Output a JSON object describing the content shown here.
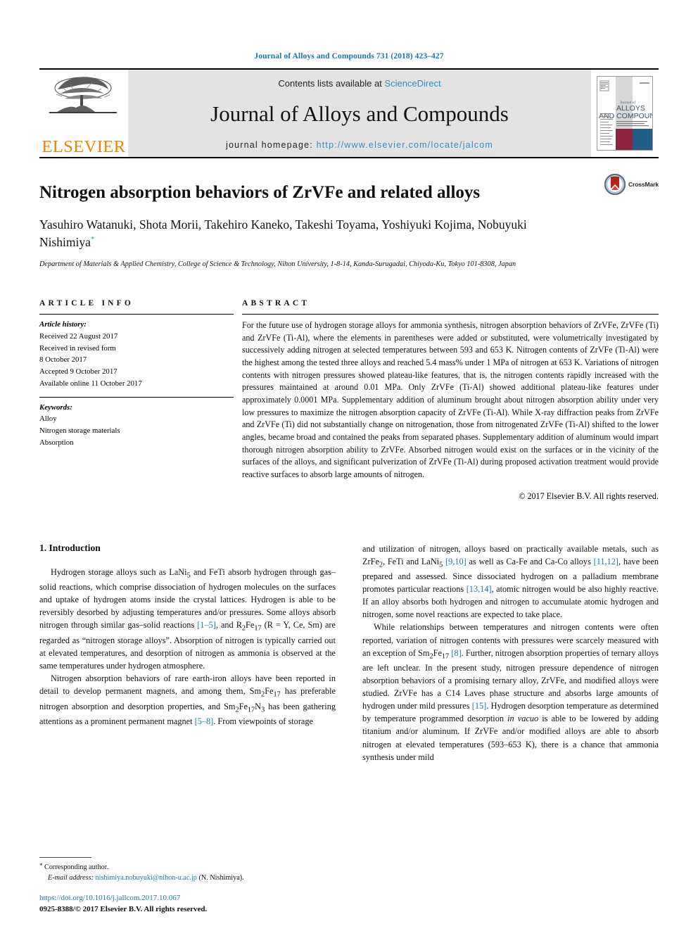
{
  "running_head": "Journal of Alloys and Compounds 731 (2018) 423–427",
  "masthead": {
    "publisher": "ELSEVIER",
    "contents_prefix": "Contents lists available at ",
    "contents_link": "ScienceDirect",
    "journal_name": "Journal of Alloys and Compounds",
    "homepage_prefix": "journal homepage: ",
    "homepage_url": "http://www.elsevier.com/locate/jalcom",
    "cover_title_small": "Journal of",
    "cover_title_line1": "ALLOYS",
    "cover_title_line2": "AND COMPOUNDS",
    "accent_link_color": "#2f8fc4",
    "publisher_color": "#ef8200",
    "panel_color": "#e3e3e3",
    "cover_maroon": "#8d2341",
    "cover_blue": "#1f5e86"
  },
  "article": {
    "title": "Nitrogen absorption behaviors of ZrVFe and related alloys",
    "authors": "Yasuhiro Watanuki, Shota Morii, Takehiro Kaneko, Takeshi Toyama, Yoshiyuki Kojima, Nobuyuki Nishimiya",
    "corresponding_marker": "*",
    "affiliation": "Department of Materials & Applied Chemistry, College of Science & Technology, Nihon University, 1-8-14, Kanda-Surugadai, Chiyoda-Ku, Tokyo 101-8308, Japan",
    "crossmark_label": "CrossMark"
  },
  "article_info": {
    "heading": "ARTICLE INFO",
    "history_label": "Article history:",
    "history": [
      "Received 22 August 2017",
      "Received in revised form",
      "8 October 2017",
      "Accepted 9 October 2017",
      "Available online 11 October 2017"
    ],
    "keywords_label": "Keywords:",
    "keywords": [
      "Alloy",
      "Nitrogen storage materials",
      "Absorption"
    ]
  },
  "abstract": {
    "heading": "ABSTRACT",
    "text": "For the future use of hydrogen storage alloys for ammonia synthesis, nitrogen absorption behaviors of ZrVFe, ZrVFe (Ti) and ZrVFe (Ti-Al), where the elements in parentheses were added or substituted, were volumetrically investigated by successively adding nitrogen at selected temperatures between 593 and 653 K. Nitrogen contents of ZrVFe (Ti-Al) were the highest among the tested three alloys and reached 5.4 mass% under 1 MPa of nitrogen at 653 K. Variations of nitrogen contents with nitrogen pressures showed plateau-like features, that is, the nitrogen contents rapidly increased with the pressures maintained at around 0.01 MPa. Only ZrVFe (Ti-Al) showed additional plateau-like features under approximately 0.0001 MPa. Supplementary addition of aluminum brought about nitrogen absorption ability under very low pressures to maximize the nitrogen absorption capacity of ZrVFe (Ti-Al). While X-ray diffraction peaks from ZrVFe and ZrVFe (Ti) did not substantially change on nitrogenation, those from nitrogenated ZrVFe (Ti-Al) shifted to the lower angles, became broad and contained the peaks from separated phases. Supplementary addition of aluminum would impart thorough nitrogen absorption ability to ZrVFe. Absorbed nitrogen would exist on the surfaces or in the vicinity of the surfaces of the alloys, and significant pulverization of ZrVFe (Ti-Al) during proposed activation treatment would provide reactive surfaces to absorb large amounts of nitrogen.",
    "copyright": "© 2017 Elsevier B.V. All rights reserved."
  },
  "introduction": {
    "section_number_title": "1. Introduction",
    "left_paragraphs": [
      {
        "id": "p1",
        "parts": [
          {
            "t": "Hydrogen storage alloys such as LaNi"
          },
          {
            "t": "5",
            "sub": true
          },
          {
            "t": " and FeTi absorb hydrogen through gas–solid reactions, which comprise dissociation of hydrogen molecules on the surfaces and uptake of hydrogen atoms inside the crystal lattices. Hydrogen is able to be reversibly desorbed by adjusting temperatures and/or pressures. Some alloys absorb nitrogen through similar gas–solid reactions "
          },
          {
            "t": "[1–5]",
            "ref": true
          },
          {
            "t": ", and R"
          },
          {
            "t": "2",
            "sub": true
          },
          {
            "t": "Fe"
          },
          {
            "t": "17",
            "sub": true
          },
          {
            "t": " (R = Y, Ce, Sm) are regarded as “nitrogen storage alloys”. Absorption of nitrogen is typically carried out at elevated temperatures, and desorption of nitrogen as ammonia is observed at the same temperatures under hydrogen atmosphere."
          }
        ]
      },
      {
        "id": "p2",
        "parts": [
          {
            "t": "Nitrogen absorption behaviors of rare earth-iron alloys have been reported in detail to develop permanent magnets, and among them, Sm"
          },
          {
            "t": "2",
            "sub": true
          },
          {
            "t": "Fe"
          },
          {
            "t": "17",
            "sub": true
          },
          {
            "t": " has preferable nitrogen absorption and desorption properties, and Sm"
          },
          {
            "t": "2",
            "sub": true
          },
          {
            "t": "Fe"
          },
          {
            "t": "17",
            "sub": true
          },
          {
            "t": "N"
          },
          {
            "t": "3",
            "sub": true
          },
          {
            "t": " has been gathering attentions as a prominent permanent magnet "
          },
          {
            "t": "[5–8]",
            "ref": true
          },
          {
            "t": ". From viewpoints of storage"
          }
        ]
      }
    ],
    "right_paragraphs": [
      {
        "id": "p3",
        "indent": false,
        "parts": [
          {
            "t": "and utilization of nitrogen, alloys based on practically available metals, such as ZrFe"
          },
          {
            "t": "2",
            "sub": true
          },
          {
            "t": ", FeTi and LaNi"
          },
          {
            "t": "5",
            "sub": true
          },
          {
            "t": " "
          },
          {
            "t": "[9,10]",
            "ref": true
          },
          {
            "t": " as well as Ca-Fe and Ca-Co alloys "
          },
          {
            "t": "[11,12]",
            "ref": true
          },
          {
            "t": ", have been prepared and assessed. Since dissociated hydrogen on a palladium membrane promotes particular reactions "
          },
          {
            "t": "[13,14]",
            "ref": true
          },
          {
            "t": ", atomic nitrogen would be also highly reactive. If an alloy absorbs both hydrogen and nitrogen to accumulate atomic hydrogen and nitrogen, some novel reactions are expected to take place."
          }
        ]
      },
      {
        "id": "p4",
        "indent": true,
        "parts": [
          {
            "t": "While relationships between temperatures and nitrogen contents were often reported, variation of nitrogen contents with pressures were scarcely measured with an exception of Sm"
          },
          {
            "t": "2",
            "sub": true
          },
          {
            "t": "Fe"
          },
          {
            "t": "17",
            "sub": true
          },
          {
            "t": " "
          },
          {
            "t": "[8]",
            "ref": true
          },
          {
            "t": ". Further, nitrogen absorption properties of ternary alloys are left unclear. In the present study, nitrogen pressure dependence of nitrogen absorption behaviors of a promising ternary alloy, ZrVFe, and modified alloys were studied. ZrVFe has a C14 Laves phase structure and absorbs large amounts of hydrogen under mild pressures "
          },
          {
            "t": "[15]",
            "ref": true
          },
          {
            "t": ". Hydrogen desorption temperature as determined by temperature programmed desorption "
          },
          {
            "t": "in vacuo",
            "ital": true
          },
          {
            "t": " is able to be lowered by adding titanium and/or aluminum. If ZrVFe and/or modified alloys are able to absorb nitrogen at elevated temperatures (593–653 K), there is a chance that ammonia synthesis under mild"
          }
        ]
      }
    ]
  },
  "footer": {
    "corresponding_star": "*",
    "corresponding_label": "Corresponding author.",
    "email_label": "E-mail address:",
    "email": "nishimiya.nobuyuki@nihon-u.ac.jp",
    "email_person": "(N. Nishimiya).",
    "doi": "https://doi.org/10.1016/j.jallcom.2017.10.067",
    "issn_line": "0925-8388/© 2017 Elsevier B.V. All rights reserved."
  }
}
